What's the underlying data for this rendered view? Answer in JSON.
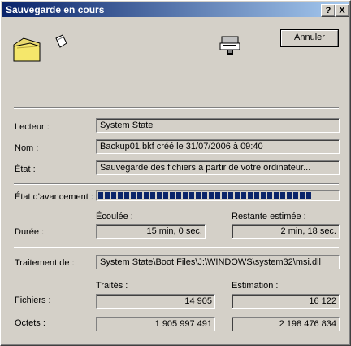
{
  "window": {
    "title": "Sauvegarde en cours",
    "help_button": "?",
    "close_button": "X"
  },
  "cancel_button": "Annuler",
  "icons": {
    "folder": "folder-icon",
    "flying_page": "document-icon",
    "backup_device": "tape-drive-icon"
  },
  "info": {
    "drive_label": "Lecteur :",
    "drive_value": "System State",
    "name_label": "Nom :",
    "name_value": "Backup01.bkf créé le 31/07/2006 à 09:40",
    "state_label": "État :",
    "state_value": "Sauvegarde des fichiers à partir de votre ordinateur..."
  },
  "progress": {
    "label": "État d'avancement :",
    "fraction": 0.92
  },
  "duration": {
    "elapsed_header": "Écoulée :",
    "remaining_header": "Restante estimée :",
    "label": "Durée :",
    "elapsed_value": "15 min, 0 sec.",
    "remaining_value": "2 min, 18 sec."
  },
  "processing": {
    "label": "Traitement de :",
    "value": "System State\\Boot Files\\J:\\WINDOWS\\system32\\msi.dll"
  },
  "stats": {
    "processed_header": "Traités :",
    "estimate_header": "Estimation :",
    "files_label": "Fichiers :",
    "files_processed": "14 905",
    "files_estimate": "16 122",
    "bytes_label": "Octets :",
    "bytes_processed": "1 905 997 491",
    "bytes_estimate": "2 198 476 834"
  }
}
